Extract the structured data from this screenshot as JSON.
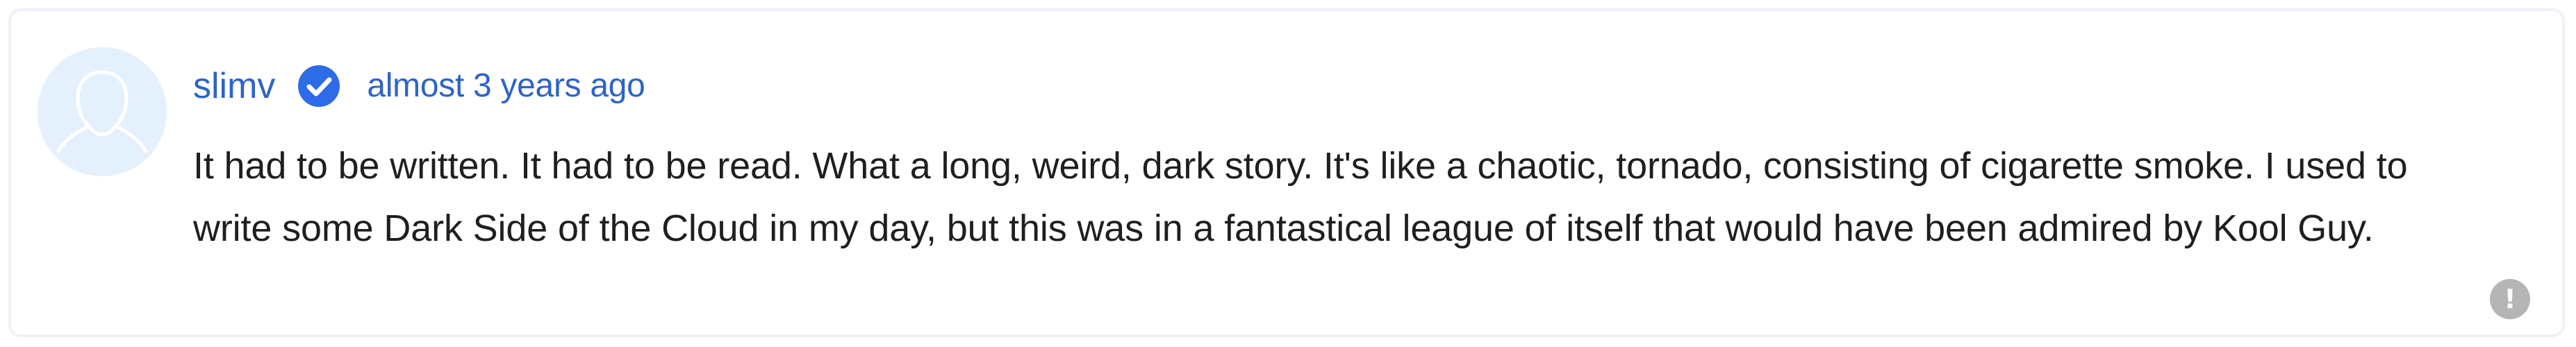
{
  "comment": {
    "username": "slimv",
    "verified": true,
    "verified_icon": "verified-check-badge-icon",
    "timestamp": "almost 3 years ago",
    "body": "It had to be written. It had to be read. What a long, weird, dark story. It's like a chaotic, tornado, consisting of cigarette smoke. I used to write some Dark Side of the Cloud in my day, but this was in a fantastical league of itself that would have been admired by Kool Guy.",
    "avatar_icon": "default-user-avatar-icon",
    "report_icon": "report-exclamation-icon",
    "report_glyph": "!"
  },
  "colors": {
    "link_blue": "#2d63c8",
    "verified_blue": "#2e6be6",
    "avatar_background": "#e4f1fc",
    "text_primary": "#1f1f1f",
    "report_icon_gray": "#b5b5b5",
    "card_border": "#eef2f7"
  }
}
